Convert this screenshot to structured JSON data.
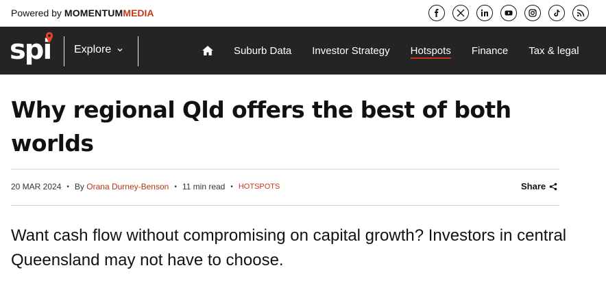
{
  "topbar": {
    "powered_prefix": "Powered by",
    "brand_part1": "MOMENTUM",
    "brand_part2": "MEDIA",
    "socials": [
      "facebook-icon",
      "x-icon",
      "linkedin-icon",
      "youtube-icon",
      "instagram-icon",
      "tiktok-icon",
      "rss-icon"
    ]
  },
  "nav": {
    "logo": "spi",
    "explore_label": "Explore",
    "links": [
      "Suburb Data",
      "Investor Strategy",
      "Hotspots",
      "Finance",
      "Tax & legal"
    ],
    "active": "Hotspots"
  },
  "article": {
    "title": "Why regional Qld offers the best of both worlds",
    "date": "20 MAR 2024",
    "by": "By",
    "author": "Orana Durney-Benson",
    "read_time": "11 min read",
    "category": "HOTSPOTS",
    "share_label": "Share",
    "lede": "Want cash flow without compromising on capital growth? Investors in central Queensland may not have to choose."
  },
  "colors": {
    "accent": "#c7361c",
    "nav_bg": "#252323"
  }
}
